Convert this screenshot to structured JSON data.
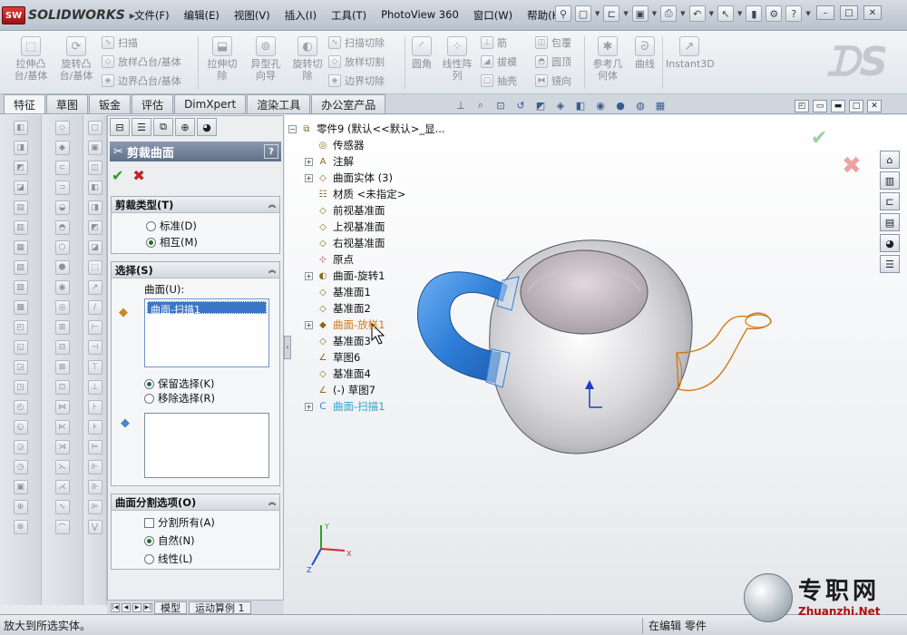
{
  "app": {
    "logo_text": "SOLIDWORKS",
    "logo_badge": "SW"
  },
  "menu": [
    "文件(F)",
    "编辑(E)",
    "视图(V)",
    "插入(I)",
    "工具(T)",
    "PhotoView 360",
    "窗口(W)",
    "帮助(H)"
  ],
  "window_buttons": [
    "–",
    "□",
    "✕"
  ],
  "ribbon": {
    "big": [
      {
        "label": "拉伸凸\n台/基体",
        "icon": "extrude-boss-icon"
      },
      {
        "label": "旋转凸\n台/基体",
        "icon": "revolve-boss-icon"
      },
      {
        "label": "拉伸切\n除",
        "icon": "extrude-cut-icon"
      },
      {
        "label": "异型孔\n向导",
        "icon": "hole-wizard-icon"
      },
      {
        "label": "旋转切\n除",
        "icon": "revolve-cut-icon"
      },
      {
        "label": "圆角",
        "icon": "fillet-icon"
      },
      {
        "label": "线性阵\n列",
        "icon": "linear-pattern-icon"
      },
      {
        "label": "参考几\n何体",
        "icon": "reference-geometry-icon"
      },
      {
        "label": "曲线",
        "icon": "curves-icon"
      },
      {
        "label": "Instant3D",
        "icon": "instant3d-icon"
      }
    ],
    "small": [
      {
        "label": "扫描",
        "icon": "sweep-icon"
      },
      {
        "label": "放样凸台/基体",
        "icon": "loft-icon"
      },
      {
        "label": "边界凸台/基体",
        "icon": "boundary-icon"
      },
      {
        "label": "扫描切除",
        "icon": "swept-cut-icon"
      },
      {
        "label": "放样切割",
        "icon": "lofted-cut-icon"
      },
      {
        "label": "边界切除",
        "icon": "boundary-cut-icon"
      },
      {
        "label": "筋",
        "icon": "rib-icon"
      },
      {
        "label": "拔模",
        "icon": "draft-icon"
      },
      {
        "label": "抽壳",
        "icon": "shell-icon"
      },
      {
        "label": "包覆",
        "icon": "wrap-icon"
      },
      {
        "label": "圆顶",
        "icon": "dome-icon"
      },
      {
        "label": "镜向",
        "icon": "mirror-icon"
      }
    ]
  },
  "tabs": [
    "特征",
    "草图",
    "钣金",
    "评估",
    "DimXpert",
    "渲染工具",
    "办公室产品"
  ],
  "property_manager": {
    "title": "剪裁曲面",
    "help": "?",
    "ok": "✔",
    "cancel": "✖",
    "trim_type": {
      "header": "剪裁类型(T)",
      "standard": "标准(D)",
      "mutual": "相互(M)"
    },
    "selection": {
      "header": "选择(S)",
      "surface_label": "曲面(U):",
      "surface_item": "曲面-扫描1",
      "keep": "保留选择(K)",
      "remove": "移除选择(R)"
    },
    "split": {
      "header": "曲面分割选项(O)",
      "split_all": "分割所有(A)",
      "natural": "自然(N)",
      "linear": "线性(L)"
    }
  },
  "bottom_tabs": [
    "模型",
    "运动算例 1"
  ],
  "tree": [
    {
      "label": "零件9  (默认<<默认>_显...",
      "icon": "part-icon",
      "color": "#111111",
      "expand": "−"
    },
    {
      "label": "传感器",
      "icon": "sensor-icon",
      "color": "#111111",
      "expand": ""
    },
    {
      "label": "注解",
      "icon": "annotation-icon",
      "color": "#111111",
      "expand": "+"
    },
    {
      "label": "曲面实体 (3)",
      "icon": "surface-bodies-icon",
      "color": "#111111",
      "expand": "+"
    },
    {
      "label": "材质 <未指定>",
      "icon": "material-icon",
      "color": "#111111",
      "expand": ""
    },
    {
      "label": "前视基准面",
      "icon": "plane-icon",
      "color": "#111111",
      "expand": ""
    },
    {
      "label": "上视基准面",
      "icon": "plane-icon",
      "color": "#111111",
      "expand": ""
    },
    {
      "label": "右视基准面",
      "icon": "plane-icon",
      "color": "#111111",
      "expand": ""
    },
    {
      "label": "原点",
      "icon": "origin-icon",
      "color": "#111111",
      "expand": ""
    },
    {
      "label": "曲面-旋转1",
      "icon": "surface-revolve-icon",
      "color": "#111111",
      "expand": "+"
    },
    {
      "label": "基准面1",
      "icon": "plane-icon",
      "color": "#111111",
      "expand": ""
    },
    {
      "label": "基准面2",
      "icon": "plane-icon",
      "color": "#111111",
      "expand": ""
    },
    {
      "label": "曲面-放样1",
      "icon": "surface-loft-icon",
      "color": "#d27a18",
      "expand": "+"
    },
    {
      "label": "基准面3",
      "icon": "plane-icon",
      "color": "#111111",
      "expand": ""
    },
    {
      "label": "草图6",
      "icon": "sketch-icon",
      "color": "#111111",
      "expand": ""
    },
    {
      "label": "基准面4",
      "icon": "plane-icon",
      "color": "#111111",
      "expand": ""
    },
    {
      "label": "(-) 草图7",
      "icon": "sketch-icon",
      "color": "#111111",
      "expand": ""
    },
    {
      "label": "曲面-扫描1",
      "icon": "surface-sweep-icon",
      "color": "#2fa6c9",
      "expand": "+"
    }
  ],
  "status": {
    "left": "放大到所选实体。",
    "mode": "在编辑 零件"
  },
  "watermark": {
    "title": "专职网",
    "url": "Zhuanzhi.Net"
  },
  "colors": {
    "handle": "#2f7fd8",
    "spout": "#d27a18",
    "title_bar": "#6b7b93"
  }
}
